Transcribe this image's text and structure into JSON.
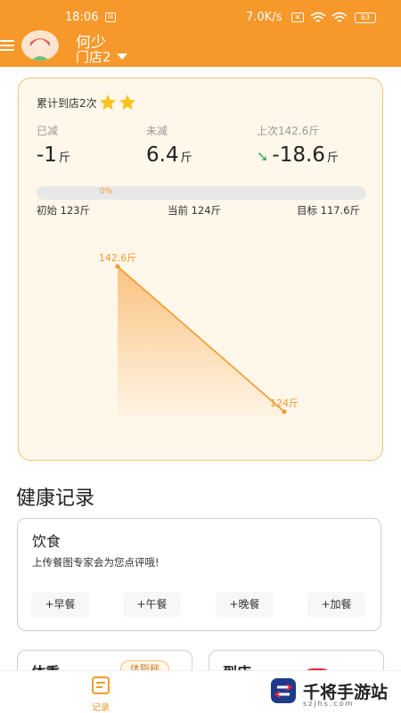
{
  "status_bar": {
    "time": "18:06",
    "time_badge": "✉",
    "net_speed": "7.0K/s",
    "sim_badge": "✕",
    "battery": "63"
  },
  "header": {
    "user_name": "何少",
    "store": "门店2"
  },
  "summary": {
    "visits": "累计到店2次",
    "stats": [
      {
        "label": "已减",
        "value": "-1",
        "unit": "斤"
      },
      {
        "label": "未减",
        "value": "6.4",
        "unit": "斤"
      },
      {
        "label": "上次142.6斤",
        "value": "-18.6",
        "unit": "斤"
      }
    ],
    "progress": {
      "percent_label": "0%",
      "percent": 0,
      "start": "初始 123斤",
      "current": "当前 124斤",
      "target": "目标 117.6斤"
    }
  },
  "chart_data": {
    "type": "area",
    "x": [
      1,
      2
    ],
    "values": [
      142.6,
      124
    ],
    "point_labels": [
      "142.6斤",
      "124斤"
    ],
    "color": "#f7982b"
  },
  "health": {
    "title": "健康记录",
    "diet": {
      "title": "饮食",
      "desc": "上传餐图专家会为您点评哦!",
      "buttons": [
        "+早餐",
        "+午餐",
        "+晚餐",
        "+加餐"
      ]
    },
    "weight": {
      "title": "体重",
      "badge": "体脂秤"
    },
    "visit": {
      "title": "到店"
    }
  },
  "tabbar": {
    "record_label": "记录"
  },
  "watermark": {
    "title": "千将手游站",
    "sub": "szjhs.com"
  },
  "colors": {
    "brand": "#f7982b",
    "down_arrow": "#2bb24c",
    "card_bg": "#fff7ea"
  }
}
